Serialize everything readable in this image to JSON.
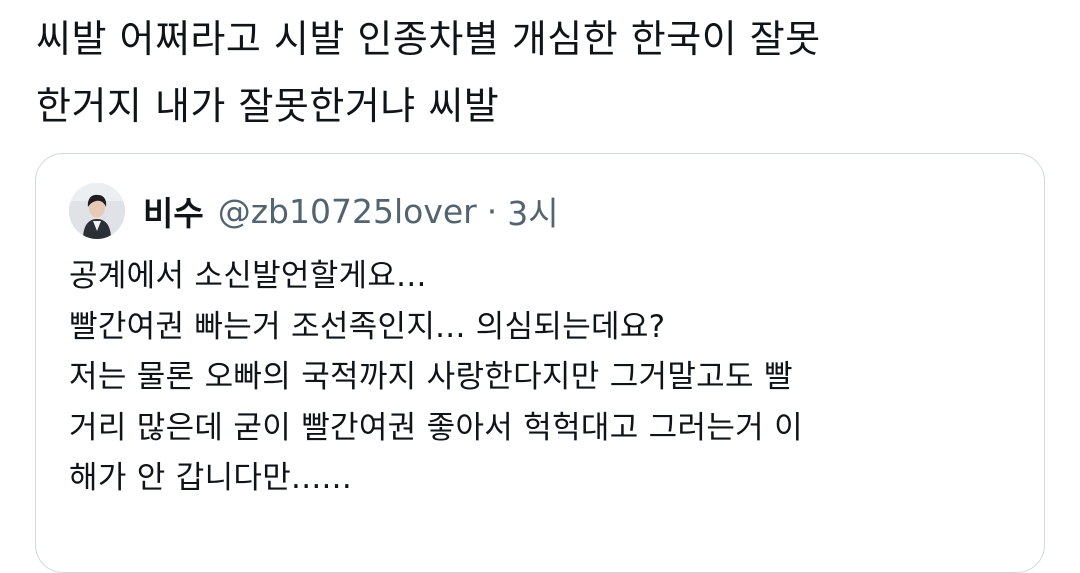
{
  "tweet": {
    "text_lines": [
      "씨발 어쩌라고 시발 인종차별 개심한 한국이 잘못",
      "한거지 내가 잘못한거냐 씨발"
    ]
  },
  "quoted_tweet": {
    "display_name": "비수",
    "handle": "@zb10725lover",
    "separator": "·",
    "time": "3시",
    "avatar_icon": "profile-photo",
    "text_lines": [
      "공계에서 소신발언할게요...",
      "빨간여권 빠는거 조선족인지... 의심되는데요?",
      "저는 물론 오빠의 국적까지 사랑한다지만 그거말고도 빨",
      "거리 많은데 굳이 빨간여권 좋아서 헉헉대고 그러는거 이",
      "해가 안 갑니다만......"
    ]
  },
  "colors": {
    "text_primary": "#0f1419",
    "text_secondary": "#536471",
    "card_border": "#cfd9de",
    "background": "#ffffff"
  }
}
